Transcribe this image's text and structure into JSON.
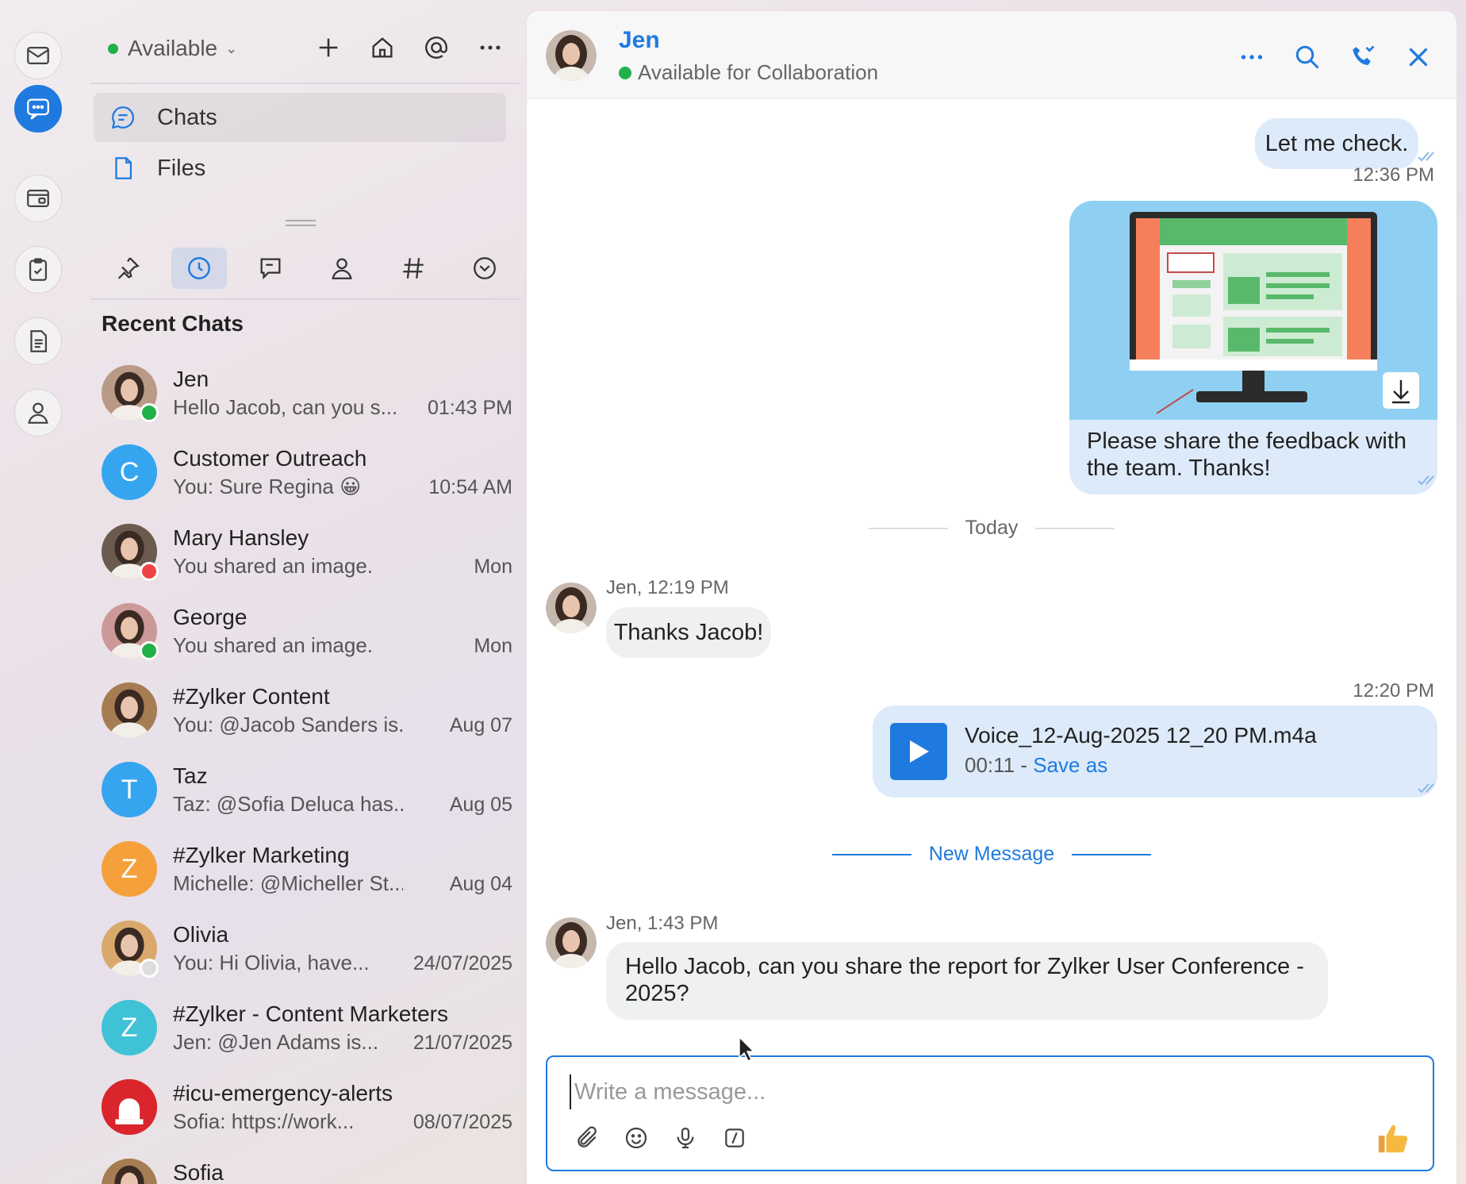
{
  "status": {
    "label": "Available",
    "color": "#22b04b"
  },
  "nav": {
    "chats": "Chats",
    "files": "Files"
  },
  "recent": {
    "title": "Recent Chats",
    "items": [
      {
        "name": "Jen",
        "preview": "Hello Jacob, can you s...",
        "time": "01:43 PM",
        "avatar": "photo",
        "badge": "#22b04b"
      },
      {
        "name": "Customer Outreach",
        "preview": "You: Sure Regina 😀",
        "time": "10:54 AM",
        "avatar": "C",
        "color": "#36a5ef"
      },
      {
        "name": "Mary  Hansley",
        "preview": "You shared an image.",
        "time": "Mon",
        "avatar": "photo",
        "badge": "#ef4444"
      },
      {
        "name": "George",
        "preview": "You shared an image.",
        "time": "Mon",
        "avatar": "photo",
        "badge": "#22b04b"
      },
      {
        "name": "#Zylker Content",
        "preview": "You: @Jacob Sanders  is...",
        "time": "Aug 07",
        "avatar": "photo"
      },
      {
        "name": "Taz",
        "preview": "Taz: @Sofia Deluca has...",
        "time": "Aug 05",
        "avatar": "T",
        "color": "#36a5ef"
      },
      {
        "name": "#Zylker Marketing",
        "preview": "Michelle: @Micheller St...",
        "time": "Aug 04",
        "avatar": "Z",
        "color": "#f6a03b"
      },
      {
        "name": "Olivia",
        "preview": "You: Hi Olivia, have...",
        "time": "24/07/2025",
        "avatar": "photo",
        "badge": "#dddddd"
      },
      {
        "name": "#Zylker - Content Marketers",
        "preview": "Jen: @Jen Adams  is...",
        "time": "21/07/2025",
        "avatar": "Z",
        "color": "#3fc2d6"
      },
      {
        "name": "#icu-emergency-alerts",
        "preview": "Sofia: https://work...",
        "time": "08/07/2025",
        "avatar": "emergency"
      },
      {
        "name": "Sofia",
        "preview": "",
        "time": "",
        "avatar": "photo"
      }
    ]
  },
  "conversation": {
    "name": "Jen",
    "status": "Available for Collaboration",
    "messages": {
      "m1": "Let me check.",
      "t1": "12:36 PM",
      "img_caption": "Please share the feedback with the team. Thanks!",
      "today": "Today",
      "s1": "Jen, 12:19 PM",
      "m2": "Thanks Jacob!",
      "t2": "12:20 PM",
      "voice_name": "Voice_12-Aug-2025 12_20 PM.m4a",
      "voice_duration": "00:11 - ",
      "voice_save": "Save as",
      "new_msg": "New Message",
      "s2": "Jen, 1:43 PM",
      "m3": "Hello Jacob, can you share the report for Zylker User Conference - 2025?"
    },
    "composer_placeholder": "Write a message..."
  },
  "colors": {
    "accent": "#1f7ae0",
    "bubble_out": "#ddeaf9",
    "bubble_in": "#eef0f2"
  }
}
